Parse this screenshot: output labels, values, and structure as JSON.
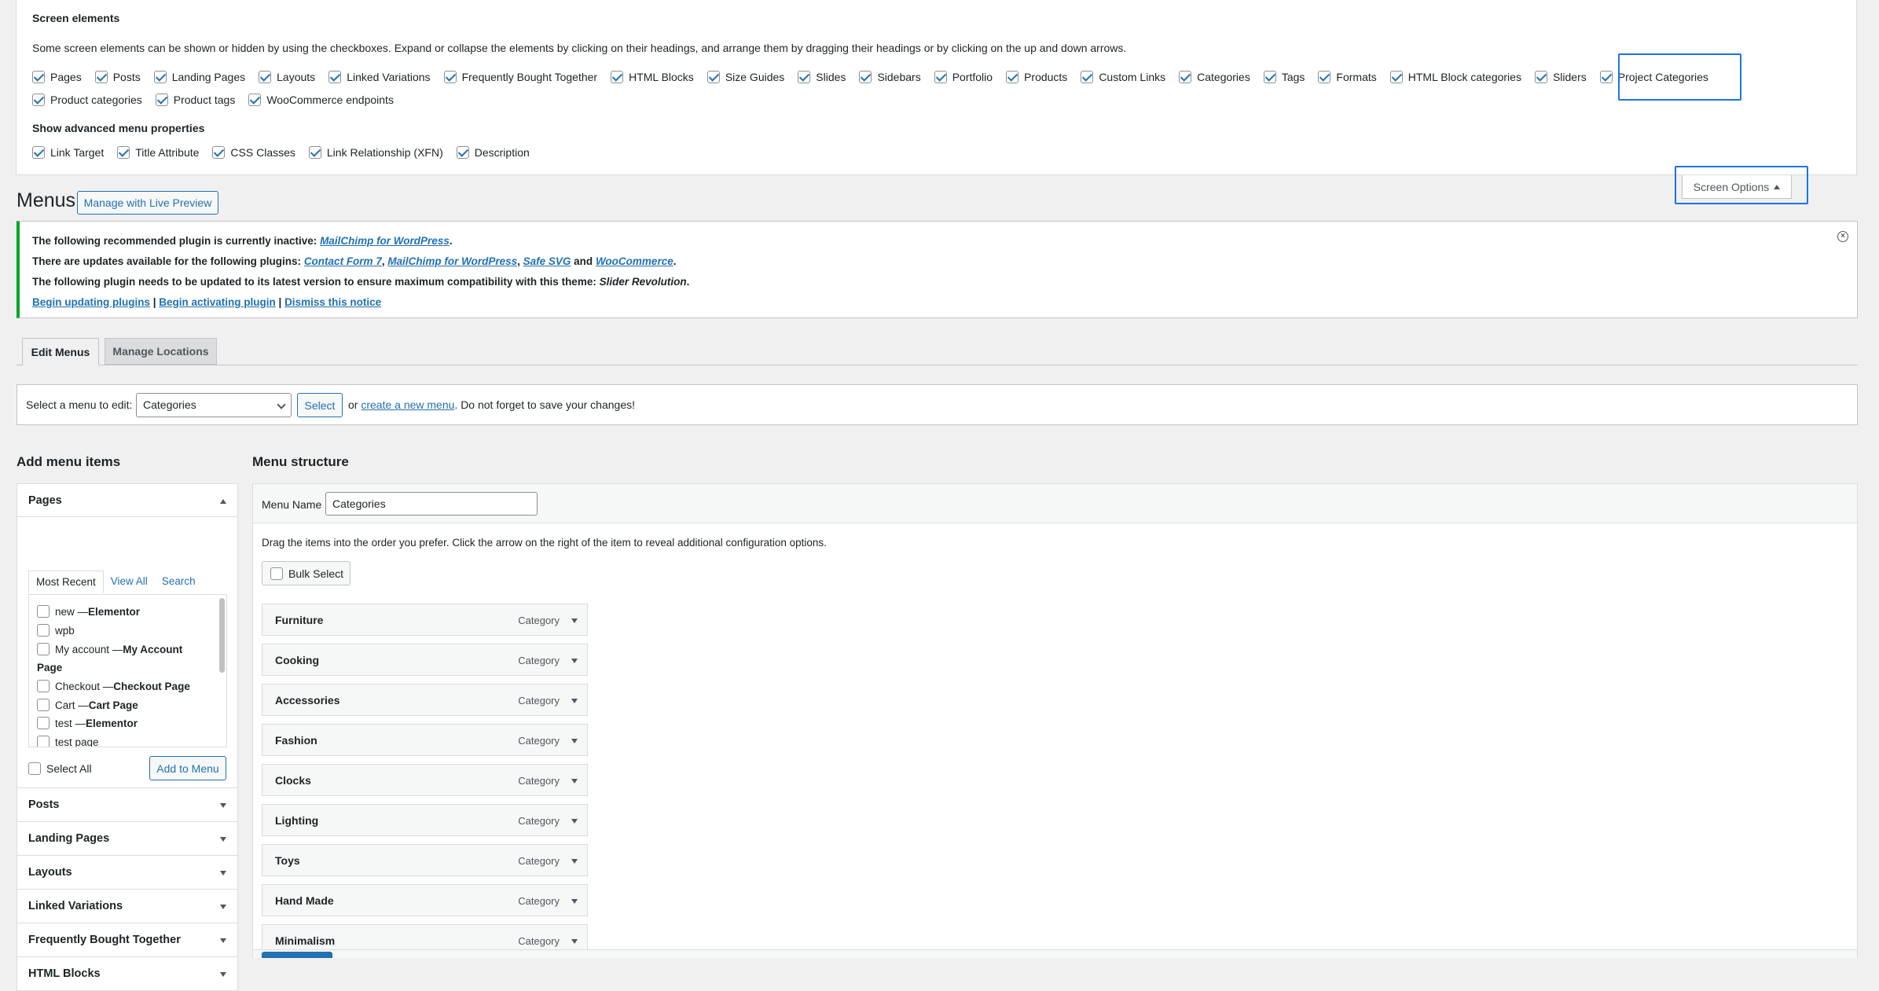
{
  "screen_options": {
    "elements_heading": "Screen elements",
    "elements_help": "Some screen elements can be shown or hidden by using the checkboxes. Expand or collapse the elements by clicking on their headings, and arrange them by dragging their headings or by clicking on the up and down arrows.",
    "elements": [
      {
        "label": "Pages",
        "checked": true
      },
      {
        "label": "Posts",
        "checked": true
      },
      {
        "label": "Landing Pages",
        "checked": true
      },
      {
        "label": "Layouts",
        "checked": true
      },
      {
        "label": "Linked Variations",
        "checked": true
      },
      {
        "label": "Frequently Bought Together",
        "checked": true
      },
      {
        "label": "HTML Blocks",
        "checked": true
      },
      {
        "label": "Size Guides",
        "checked": true
      },
      {
        "label": "Slides",
        "checked": true
      },
      {
        "label": "Sidebars",
        "checked": true
      },
      {
        "label": "Portfolio",
        "checked": true
      },
      {
        "label": "Products",
        "checked": true
      },
      {
        "label": "Custom Links",
        "checked": true
      },
      {
        "label": "Categories",
        "checked": true
      },
      {
        "label": "Tags",
        "checked": true
      },
      {
        "label": "Formats",
        "checked": true
      },
      {
        "label": "HTML Block categories",
        "checked": true
      },
      {
        "label": "Sliders",
        "checked": true
      },
      {
        "label": "Project Categories",
        "checked": true
      },
      {
        "label": "Product categories",
        "checked": true
      },
      {
        "label": "Product tags",
        "checked": true
      },
      {
        "label": "WooCommerce endpoints",
        "checked": true
      }
    ],
    "advanced_heading": "Show advanced menu properties",
    "advanced": [
      {
        "label": "Link Target",
        "checked": true
      },
      {
        "label": "Title Attribute",
        "checked": true
      },
      {
        "label": "CSS Classes",
        "checked": true
      },
      {
        "label": "Link Relationship (XFN)",
        "checked": true
      },
      {
        "label": "Description",
        "checked": true
      }
    ],
    "toggle_label": "Screen Options"
  },
  "header": {
    "title": "Menus",
    "live_preview": "Manage with Live Preview"
  },
  "notice": {
    "l1_text": "The following recommended plugin is currently inactive: ",
    "l1_link": "MailChimp for WordPress",
    "l1_end": ".",
    "l2_text": "There are updates available for the following plugins: ",
    "l2_link1": "Contact Form 7",
    "l2_sep1": ", ",
    "l2_link2": "MailChimp for WordPress",
    "l2_sep2": ", ",
    "l2_link3": "Safe SVG",
    "l2_and": " and ",
    "l2_link4": "WooCommerce",
    "l2_end": ".",
    "l3_text": "The following plugin needs to be updated to its latest version to ensure maximum compatibility with this theme: ",
    "l3_em": "Slider Revolution",
    "l3_end": ".",
    "action1": "Begin updating plugins",
    "sep": " | ",
    "action2": "Begin activating plugin",
    "action3": "Dismiss this notice"
  },
  "tabs": {
    "edit": "Edit Menus",
    "locations": "Manage Locations"
  },
  "select_bar": {
    "label": "Select a menu to edit:",
    "selected": "Categories",
    "button": "Select",
    "or": "or ",
    "create_link": "create a new menu",
    "tail": ". Do not forget to save your changes!"
  },
  "add_items": {
    "title": "Add menu items",
    "pages_title": "Pages",
    "tab_recent": "Most Recent",
    "tab_all": "View All",
    "tab_search": "Search",
    "pages": [
      {
        "name": "new — ",
        "type": "Elementor"
      },
      {
        "name": "wpb",
        "type": ""
      },
      {
        "name": "My account — ",
        "type": "My Account"
      },
      {
        "name": "Checkout — ",
        "type": "Checkout Page"
      },
      {
        "name": "Cart — ",
        "type": "Cart Page"
      },
      {
        "name": "test — ",
        "type": "Elementor"
      },
      {
        "name": "test page",
        "type": ""
      }
    ],
    "page_wrap": "Page",
    "select_all": "Select All",
    "add_button": "Add to Menu",
    "sections": [
      "Posts",
      "Landing Pages",
      "Layouts",
      "Linked Variations",
      "Frequently Bought Together",
      "HTML Blocks"
    ]
  },
  "structure": {
    "title": "Menu structure",
    "name_label": "Menu Name",
    "name_value": "Categories",
    "help": "Drag the items into the order you prefer. Click the arrow on the right of the item to reveal additional configuration options.",
    "bulk_select": "Bulk Select",
    "items": [
      {
        "name": "Furniture",
        "type": "Category"
      },
      {
        "name": "Cooking",
        "type": "Category"
      },
      {
        "name": "Accessories",
        "type": "Category"
      },
      {
        "name": "Fashion",
        "type": "Category"
      },
      {
        "name": "Clocks",
        "type": "Category"
      },
      {
        "name": "Lighting",
        "type": "Category"
      },
      {
        "name": "Toys",
        "type": "Category"
      },
      {
        "name": "Hand Made",
        "type": "Category"
      },
      {
        "name": "Minimalism",
        "type": "Category"
      }
    ]
  }
}
